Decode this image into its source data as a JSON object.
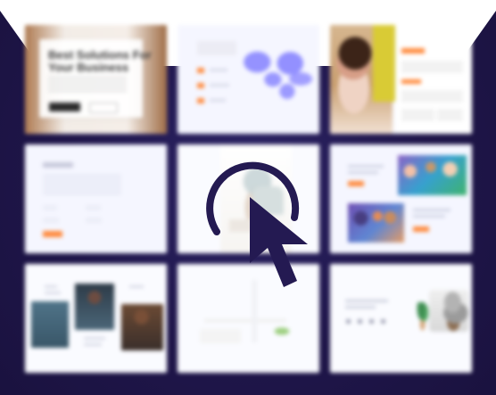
{
  "tiles": [
    {
      "title": "Best Solutions For Your Business"
    }
  ],
  "icons": {
    "cursor": "pointer-cursor-icon",
    "loading": "loading-ring-icon"
  },
  "colors": {
    "background": "#241a52",
    "accent": "#ff8a3d",
    "cursor": "#241a52"
  }
}
